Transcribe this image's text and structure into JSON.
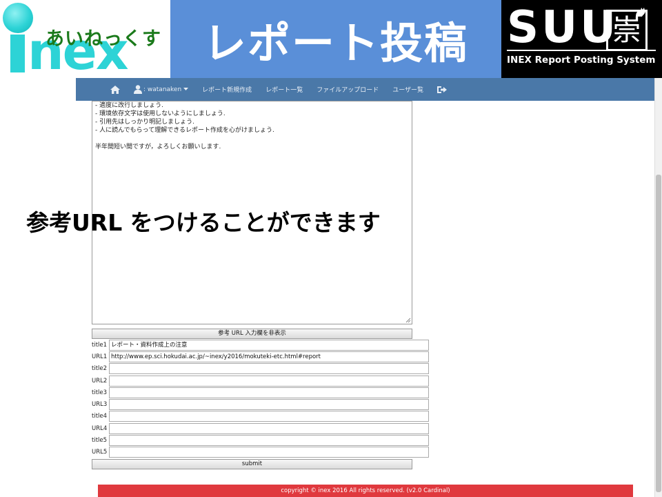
{
  "banner": {
    "logo_main": "nex",
    "logo_kana": "あいねっくす",
    "title": "レポート投稿",
    "brand_name": "SUU",
    "brand_kanji": "崇",
    "brand_subtitle": "INEX Report Posting System",
    "colors": {
      "title_bg": "#5a8fd8",
      "logo_cyan": "#2dd3d6",
      "brand_bg": "#000000"
    }
  },
  "navbar": {
    "home_icon": "home-icon",
    "user_icon": "user-icon",
    "user_label": ": watanaken",
    "items": [
      {
        "label": "レポート新規作成"
      },
      {
        "label": "レポート一覧"
      },
      {
        "label": "ファイルアップロード"
      },
      {
        "label": "ユーザー覧"
      }
    ],
    "logout_icon": "logout-icon",
    "color": "#4a78a8"
  },
  "editor": {
    "lines": [
      "- 適度に改行しましょう.",
      "- 環境依存文字は使用しないようにしましょう.",
      "- 引用先はしっかり明記しましょう.",
      "- 人に読んでもらって理解できるレポート作成を心がけましょう.",
      "",
      "半年間短い間ですが，よろしくお願いします."
    ]
  },
  "refs": {
    "toggle_label": "参考 URL 入力欄を非表示",
    "rows": [
      {
        "label": "title1",
        "value": "レポート・資料作成上の注意"
      },
      {
        "label": "URL1",
        "value": "http://www.ep.sci.hokudai.ac.jp/~inex/y2016/mokuteki-etc.html#report"
      },
      {
        "label": "title2",
        "value": ""
      },
      {
        "label": "URL2",
        "value": ""
      },
      {
        "label": "title3",
        "value": ""
      },
      {
        "label": "URL3",
        "value": ""
      },
      {
        "label": "title4",
        "value": ""
      },
      {
        "label": "URL4",
        "value": ""
      },
      {
        "label": "title5",
        "value": ""
      },
      {
        "label": "URL5",
        "value": ""
      }
    ],
    "submit_label": "submit"
  },
  "footer": {
    "text": "copyright © inex 2016 All rights reserved. (v2.0 Cardinal)",
    "color": "#e0393e"
  },
  "callout": {
    "text": "参考URL をつけることができます"
  }
}
